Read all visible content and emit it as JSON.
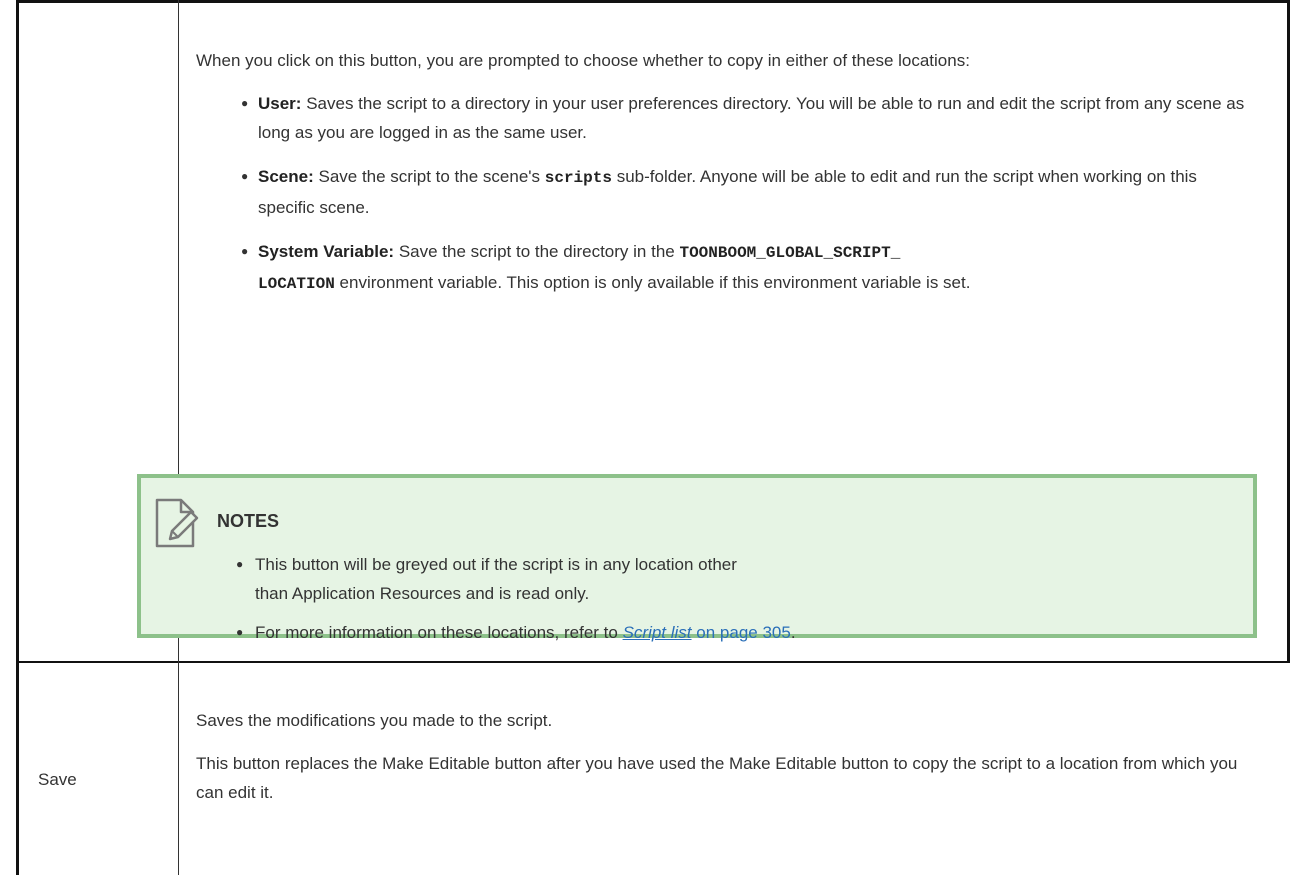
{
  "row1": {
    "intro": "When you click on this button, you are prompted to choose whether to copy in either of these locations:",
    "bullets": [
      {
        "label": "User:",
        "text": "Saves the script to a directory in your user preferences directory. You will be able to run and edit the script from any scene as long as you are logged in as the same user."
      },
      {
        "label": "Scene:",
        "text_before": "Save the script to the scene's",
        "code": "scripts",
        "text_after": "sub-folder. Anyone will be able to edit and run the script when working on this specific scene."
      },
      {
        "label": "System Variable:",
        "text_before": "Save the script to the directory in the",
        "code_line1": "TOONBOOM_GLOBAL_SCRIPT_",
        "code_line2": "LOCATION",
        "text_after": "environment variable. This option is only available if this environment variable is set."
      }
    ],
    "notes": {
      "icon": "note-pencil-icon",
      "title": "NOTES",
      "item1_line1": "This button will be greyed out if the script is in any location other",
      "item1_line2": "than Application Resources and is read only.",
      "item2_before": "For more information on these locations, refer to",
      "item2_link": "Script list",
      "item2_page": "on page 305",
      "item2_after": "."
    }
  },
  "row2": {
    "label": "Save",
    "para1": "Saves the modifications you made to the script.",
    "para2": "This button replaces the Make Editable button after you have used the Make Editable button to copy the script to a location from which you can edit it."
  },
  "colors": {
    "note_bg": "#e6f4e4",
    "note_border": "#8dc18a",
    "link": "#2a6fb8"
  }
}
